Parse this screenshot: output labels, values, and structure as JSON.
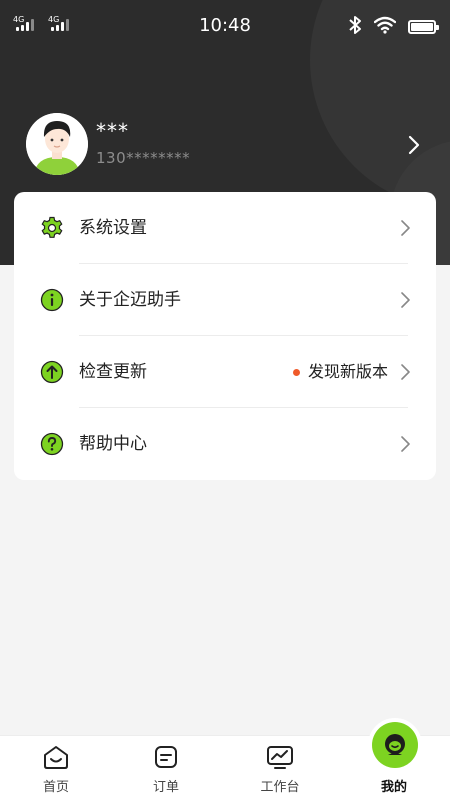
{
  "status_bar": {
    "sim1_label": "4G",
    "sim2_label": "4G",
    "time": "10:48",
    "icons": [
      "signal-icon",
      "bluetooth-icon",
      "wifi-icon",
      "battery-icon"
    ]
  },
  "profile": {
    "name": "***",
    "phone": "130********",
    "avatar": "avatar-icon"
  },
  "menu": {
    "items": [
      {
        "label": "系统设置",
        "icon": "settings-gear-icon"
      },
      {
        "label": "关于企迈助手",
        "icon": "info-icon"
      },
      {
        "label": "检查更新",
        "icon": "upload-arrow-icon",
        "badge": "发现新版本"
      },
      {
        "label": "帮助中心",
        "icon": "help-question-icon"
      }
    ]
  },
  "tabbar": {
    "tabs": [
      {
        "label": "首页",
        "icon": "home-icon"
      },
      {
        "label": "订单",
        "icon": "order-icon"
      },
      {
        "label": "工作台",
        "icon": "workbench-icon"
      },
      {
        "label": "我的",
        "icon": "mine-icon",
        "active": true
      }
    ]
  },
  "colors": {
    "header_bg": "#2c2c2c",
    "accent_green": "#7dd321",
    "badge_dot": "#ef5a2a",
    "page_bg": "#f4f4f4"
  }
}
